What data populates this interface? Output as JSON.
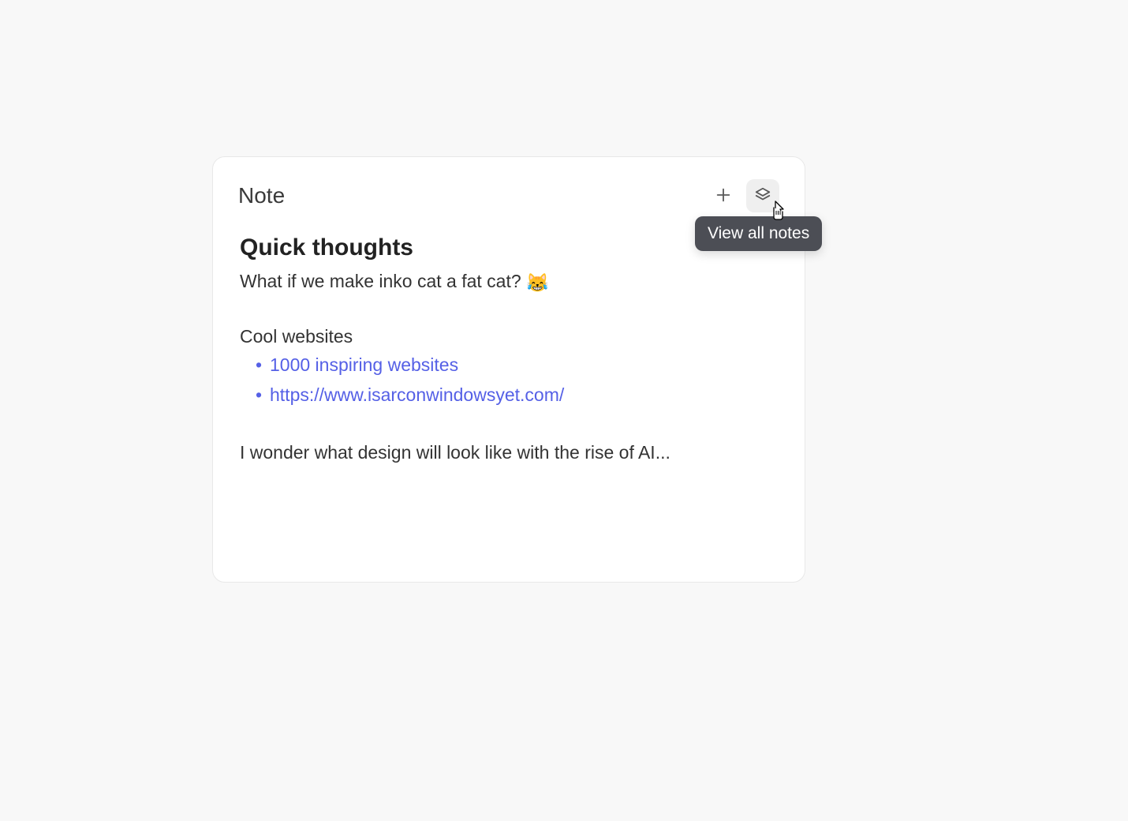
{
  "note": {
    "card_label": "Note",
    "title": "Quick thoughts",
    "body_line_1": "What if we make inko cat a fat cat? ",
    "emoji": "😹",
    "subheading": "Cool websites",
    "links": [
      "1000 inspiring websites",
      "https://www.isarconwindowsyet.com/"
    ],
    "footer_text": "I wonder what design will look like with the rise of AI..."
  },
  "tooltip": {
    "view_all": "View all notes"
  }
}
